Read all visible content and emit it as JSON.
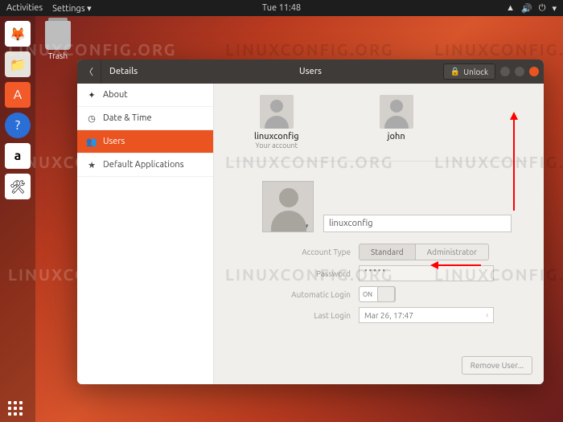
{
  "topbar": {
    "activities": "Activities",
    "settings": "Settings ▾",
    "clock": "Tue 11:48"
  },
  "desktop": {
    "trash_label": "Trash"
  },
  "window": {
    "back_section": "Details",
    "title": "Users",
    "unlock": "Unlock"
  },
  "sidebar": {
    "items": [
      {
        "label": "About"
      },
      {
        "label": "Date & Time"
      },
      {
        "label": "Users"
      },
      {
        "label": "Default Applications"
      }
    ]
  },
  "users": {
    "list": [
      {
        "name": "linuxconfig",
        "sub": "Your account"
      },
      {
        "name": "john",
        "sub": ""
      }
    ]
  },
  "form": {
    "name_value": "linuxconfig",
    "account_type_label": "Account Type",
    "standard": "Standard",
    "administrator": "Administrator",
    "password_label": "Password",
    "password_value": "•••••",
    "autologin_label": "Automatic Login",
    "autologin_state": "ON",
    "lastlogin_label": "Last Login",
    "lastlogin_value": "Mar 26, 17:47",
    "remove_user": "Remove User..."
  },
  "watermark": "LINUXCONFIG.ORG"
}
